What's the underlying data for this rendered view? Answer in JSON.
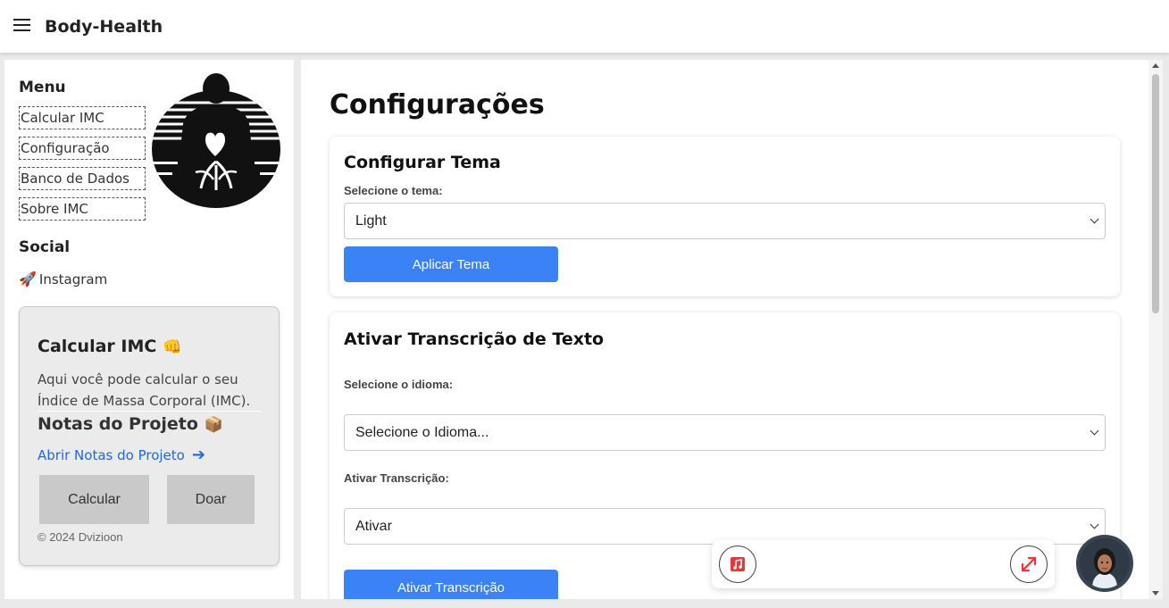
{
  "header": {
    "brand": "Body-Health"
  },
  "sidebar": {
    "menu_title": "Menu",
    "items": [
      {
        "label": "Calcular IMC"
      },
      {
        "label": "Configuração"
      },
      {
        "label": "Banco de Dados"
      },
      {
        "label": "Sobre IMC"
      }
    ],
    "social_title": "Social",
    "social_link": "Instagram",
    "social_icon": "rocket-icon",
    "card": {
      "title": "Calcular IMC",
      "title_emoji": "👊",
      "text": "Aqui você pode calcular o seu Índice de Massa Corporal (IMC).",
      "notes_title": "Notas do Projeto",
      "notes_emoji": "📦",
      "notes_link": "Abrir Notas do Projeto",
      "notes_arrow": "➔",
      "calc_button": "Calcular",
      "donate_button": "Doar",
      "copyright": "© 2024 Dvizioon"
    }
  },
  "main": {
    "title": "Configurações",
    "theme_panel": {
      "title": "Configurar Tema",
      "label": "Selecione o tema:",
      "selected": "Light",
      "button": "Aplicar Tema"
    },
    "transcription_panel": {
      "title": "Ativar Transcrição de Texto",
      "language_label": "Selecione o idioma:",
      "language_selected": "Selecione o Idioma...",
      "activate_label": "Ativar Transcrição:",
      "activate_selected": "Ativar",
      "button": "Ativar Transcrição"
    }
  },
  "widget": {
    "music_icon": "music-note-icon",
    "expand_icon": "expand-arrows-icon",
    "avatar_icon": "assistant-avatar-icon"
  },
  "colors": {
    "accent_blue": "#3b82f6",
    "link_blue": "#2563eb",
    "icon_red": "#e53935"
  }
}
